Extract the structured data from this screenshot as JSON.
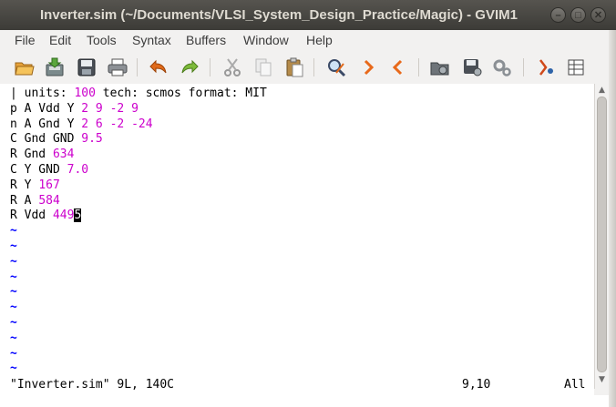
{
  "window": {
    "title": "Inverter.sim (~/Documents/VLSI_System_Design_Practice/Magic) - GVIM1",
    "controls": {
      "minimize": "–",
      "maximize": "□",
      "close": "✕"
    }
  },
  "menu": [
    "File",
    "Edit",
    "Tools",
    "Syntax",
    "Buffers",
    "Window",
    "Help"
  ],
  "toolbar": {
    "icons": [
      "open-icon",
      "save-icon",
      "save-all-icon",
      "print-icon",
      "undo-icon",
      "redo-icon",
      "cut-icon",
      "copy-icon",
      "paste-icon",
      "find-replace-icon",
      "find-next-icon",
      "find-prev-icon",
      "load-session-icon",
      "save-session-icon",
      "run-script-icon",
      "make-icon",
      "ctags-icon"
    ]
  },
  "editor": {
    "lines": [
      {
        "parts": [
          {
            "t": "| units: ",
            "c": "txt"
          },
          {
            "t": "100",
            "c": "num"
          },
          {
            "t": " tech: scmos format: MIT",
            "c": "txt"
          }
        ]
      },
      {
        "parts": [
          {
            "t": "p A Vdd Y ",
            "c": "txt"
          },
          {
            "t": "2 9 -2 9",
            "c": "num"
          }
        ]
      },
      {
        "parts": [
          {
            "t": "n A Gnd Y ",
            "c": "txt"
          },
          {
            "t": "2 6 -2 -24",
            "c": "num"
          }
        ]
      },
      {
        "parts": [
          {
            "t": "C Gnd GND ",
            "c": "txt"
          },
          {
            "t": "9.5",
            "c": "num"
          }
        ]
      },
      {
        "parts": [
          {
            "t": "R Gnd ",
            "c": "txt"
          },
          {
            "t": "634",
            "c": "num"
          }
        ]
      },
      {
        "parts": [
          {
            "t": "C Y GND ",
            "c": "txt"
          },
          {
            "t": "7.0",
            "c": "num"
          }
        ]
      },
      {
        "parts": [
          {
            "t": "R Y ",
            "c": "txt"
          },
          {
            "t": "167",
            "c": "num"
          }
        ]
      },
      {
        "parts": [
          {
            "t": "R A ",
            "c": "txt"
          },
          {
            "t": "584",
            "c": "num"
          }
        ]
      },
      {
        "parts": [
          {
            "t": "R Vdd ",
            "c": "txt"
          },
          {
            "t": "449",
            "c": "num"
          },
          {
            "t": "5",
            "c": "cursor"
          }
        ]
      }
    ],
    "tildes": [
      "~",
      "~",
      "~",
      "~",
      "~",
      "~",
      "~",
      "~",
      "~",
      "~"
    ]
  },
  "status": {
    "message": "\"Inverter.sim\" 9L, 140C",
    "position": "9,10",
    "scroll": "All"
  },
  "scrollbar": {
    "up": "▲",
    "down": "▼"
  }
}
